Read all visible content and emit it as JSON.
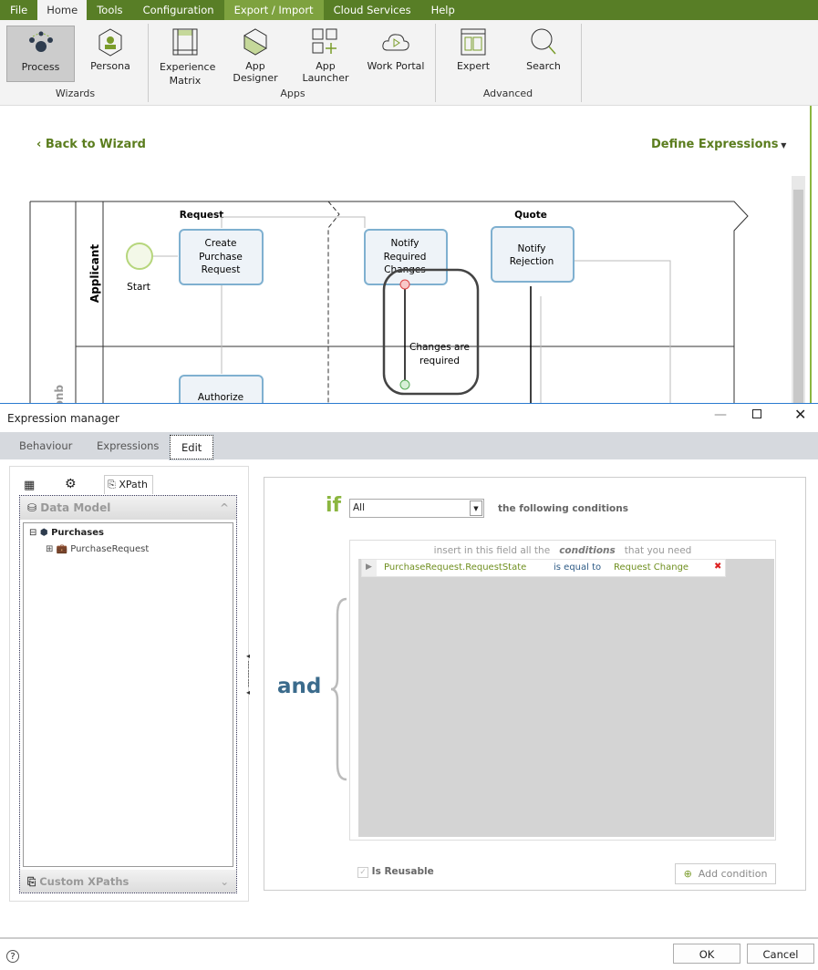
{
  "menu": [
    "File",
    "Home",
    "Tools",
    "Configuration",
    "Export / Import",
    "Cloud Services",
    "Help"
  ],
  "ribbon": {
    "wizards": {
      "label": "Wizards",
      "items": [
        "Process",
        "Persona"
      ]
    },
    "apps": {
      "label": "Apps",
      "items": [
        "Experience Matrix",
        "App Designer",
        "App Launcher",
        "Work Portal"
      ]
    },
    "advanced": {
      "label": "Advanced",
      "items": [
        "Expert",
        "Search"
      ]
    }
  },
  "nav": {
    "back": "Back to Wizard",
    "define": "Define Expressions"
  },
  "diagram": {
    "lanes": [
      "Applicant",
      "quest"
    ],
    "phases": [
      "Request",
      "Quote"
    ],
    "start": "Start",
    "tasks": {
      "create": [
        "Create",
        "Purchase",
        "Request"
      ],
      "notify_changes": [
        "Notify",
        "Required",
        "Changes"
      ],
      "notify_rejection": [
        "Notify",
        "Rejection"
      ],
      "authorize": [
        "Authorize"
      ]
    },
    "condition": [
      "Changes are",
      "required"
    ]
  },
  "dialog": {
    "title": "Expression manager",
    "tabs": [
      "Behaviour",
      "Expressions",
      "Edit"
    ],
    "left": {
      "xpath_tab": "XPath",
      "data_model": "Data Model",
      "tree": {
        "root": "Purchases",
        "child": "PurchaseRequest"
      },
      "custom_xpaths": "Custom XPaths"
    },
    "right": {
      "if": "if",
      "match_select": "All",
      "following": "the following conditions",
      "hint_pre": "insert in this field all the",
      "hint_bold": "conditions",
      "hint_post": "that you need",
      "and": "and",
      "condition": {
        "field": "PurchaseRequest.RequestState",
        "operator": "is equal to",
        "value": "Request Change"
      },
      "is_reusable": "Is Reusable",
      "is_reusable_checked": true,
      "add_condition": "Add condition"
    },
    "ok": "OK",
    "cancel": "Cancel"
  }
}
